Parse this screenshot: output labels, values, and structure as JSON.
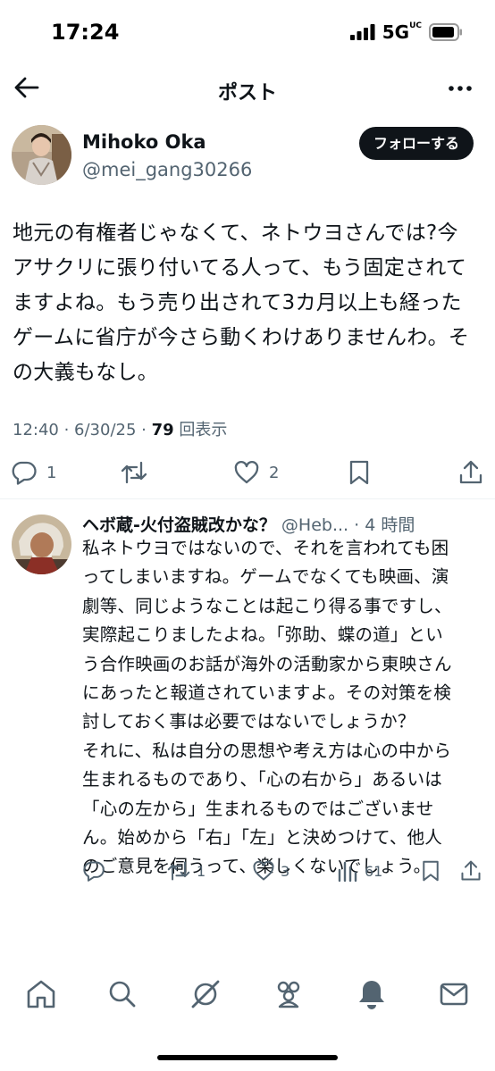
{
  "status_bar": {
    "time": "17:24",
    "network": "5G",
    "network_superscript": "UC"
  },
  "header": {
    "title": "ポスト"
  },
  "post": {
    "author_name": "Mihoko Oka",
    "author_handle": "@mei_gang30266",
    "follow_label": "フォローする",
    "lines": [
      "地元の有権者じゃなくて、ネトウヨさんでは?今",
      "アサクリに張り付いてる人って、もう固定されて",
      "ますよね。もう売り出されて3カ月以上も経った",
      "ゲームに省庁が今さら動くわけありませんわ。そ",
      "の大義もなし。"
    ],
    "meta_prefix": "12:40 · 6/30/25 · ",
    "views": "79",
    "views_label": " 回表示",
    "replies": "1",
    "reposts": "",
    "likes": "2"
  },
  "reply": {
    "author_name": "ヘボ蔵-火付盗賊改かな？",
    "author_handle": " @Heb...",
    "time": " · 4 時間",
    "lines": [
      "私ネトウヨではないので、それを言われても困",
      "ってしまいますね。ゲームでなくても映画、演",
      "劇等、同じようなことは起こり得る事ですし、",
      "実際起こりましたよね。「弥助、蝶の道」とい",
      "う合作映画のお話が海外の活動家から東映さん",
      "にあったと報道されていますよ。その対策を検",
      "討しておく事は必要ではないでしょうか？",
      "それに、私は自分の思想や考え方は心の中から",
      "生まれるものであり、「心の右から」あるいは",
      "「心の左から」生まれるものではございませ",
      "ん。始めから「右」「左」と決めつけて、他人",
      "のご意見を伺うって、楽しくないでしょう。"
    ],
    "replies": "",
    "reposts": "1",
    "likes": "3",
    "views": "61"
  },
  "colors": {
    "text": "#0f1419",
    "secondary": "#536471",
    "divider": "#eff3f4"
  },
  "icons": [
    "back-arrow-icon",
    "more-icon",
    "reply-icon",
    "repost-icon",
    "like-icon",
    "bookmark-icon",
    "share-icon",
    "views-icon",
    "home-icon",
    "search-icon",
    "grok-icon",
    "communities-icon",
    "notifications-icon",
    "messages-icon"
  ]
}
